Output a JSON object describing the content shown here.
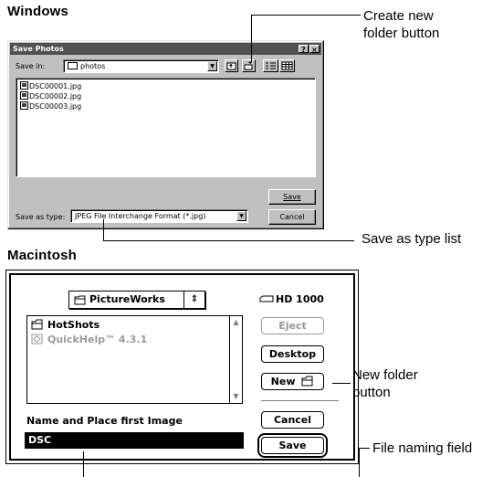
{
  "windows": {
    "heading": "Windows",
    "dialog": {
      "title": "Save Photos",
      "help_button": "?",
      "close_button": "×",
      "save_in_label": "Save in:",
      "save_in_value": "photos",
      "files": [
        "DSC00001.jpg",
        "DSC00002.jpg",
        "DSC00003.jpg"
      ],
      "save_as_type_label": "Save as type:",
      "save_as_type_value": "JPEG File Interchange Format (*.jpg)",
      "save_button": "Save",
      "cancel_button": "Cancel"
    },
    "callouts": {
      "create_folder": [
        "Create new",
        "folder button"
      ],
      "save_as_type": "Save as type list"
    }
  },
  "mac": {
    "heading": "Macintosh",
    "dialog": {
      "folder_popup": "PictureWorks",
      "items": [
        {
          "label": "HotShots",
          "icon": "folder-icon",
          "dim": false
        },
        {
          "label": "QuickHelp™ 4.3.1",
          "icon": "app-icon",
          "dim": true
        }
      ],
      "drive": "HD 1000",
      "eject_button": "Eject",
      "desktop_button": "Desktop",
      "new_button": "New",
      "cancel_button": "Cancel",
      "save_button": "Save",
      "prompt": "Name and Place first Image",
      "name_value": "DSC"
    },
    "callouts": {
      "new_folder": [
        "New folder",
        "button"
      ],
      "file_naming": "File naming field"
    }
  },
  "colors": {
    "win_face": "#c0c0c0",
    "win_titlebar": "#505050",
    "mac_disabled": "#9a9a9a"
  }
}
